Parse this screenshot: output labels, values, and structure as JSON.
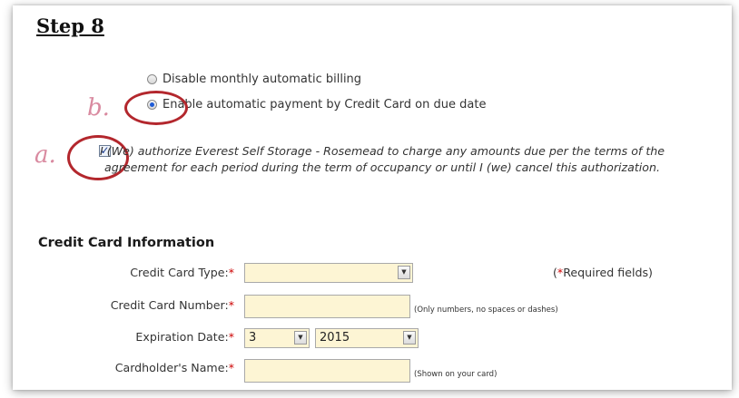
{
  "step_title": "Step 8",
  "billing_options": [
    {
      "label": "Disable monthly automatic billing",
      "checked": false
    },
    {
      "label": "Enable automatic payment by Credit Card on due date",
      "checked": true
    }
  ],
  "annotations": {
    "b": "b.",
    "a": "a."
  },
  "authorization": {
    "checked": true,
    "text": "I (We) authorize Everest Self Storage - Rosemead to charge any amounts due per the terms of the agreement for each period during the term of occupancy or until I (we) cancel this authorization."
  },
  "credit_card": {
    "section_title": "Credit Card Information",
    "required_note_prefix": "(",
    "required_note_star": "*",
    "required_note_suffix": "Required fields)",
    "required_marker": "*",
    "card_type": {
      "label": "Credit Card Type:",
      "value": ""
    },
    "card_number": {
      "label": "Credit Card Number:",
      "value": "",
      "hint": "(Only numbers, no spaces or dashes)"
    },
    "expiration": {
      "label": "Expiration Date:",
      "month": "3",
      "year": "2015"
    },
    "cardholder": {
      "label": "Cardholder's Name:",
      "value": "",
      "hint": "(Shown on your card)"
    }
  },
  "colors": {
    "field_bg": "#fdf5d4",
    "annotation_circle": "#b3272d",
    "required": "#cc0000"
  }
}
